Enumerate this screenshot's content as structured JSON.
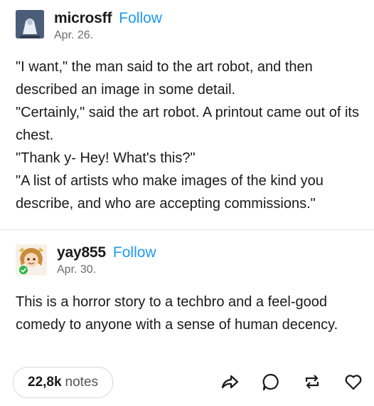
{
  "posts": [
    {
      "username": "microsff",
      "follow_label": "Follow",
      "date": "Apr. 26.",
      "avatar_icon": "robot-avatar-icon",
      "paragraphs": [
        "\"I want,\" the man said to the art robot, and then described an image in some detail.",
        "\"Certainly,\" said the art robot. A printout came out of its chest.",
        "\"Thank y- Hey! What's this?\"",
        "\"A list of artists who make images of the kind you describe, and who are accepting commissions.\""
      ]
    },
    {
      "username": "yay855",
      "follow_label": "Follow",
      "date": "Apr. 30.",
      "avatar_icon": "character-avatar-icon",
      "paragraphs": [
        "This is a horror story to a techbro and a feel-good comedy to anyone with a sense of human decency."
      ]
    }
  ],
  "footer": {
    "notes_count": "22,8k",
    "notes_label": "notes",
    "actions": [
      "share-icon",
      "reply-icon",
      "reblog-icon",
      "like-icon"
    ]
  },
  "colors": {
    "follow": "#1d9bf0",
    "text": "#1a1a1a",
    "muted": "#6b6b6b"
  }
}
